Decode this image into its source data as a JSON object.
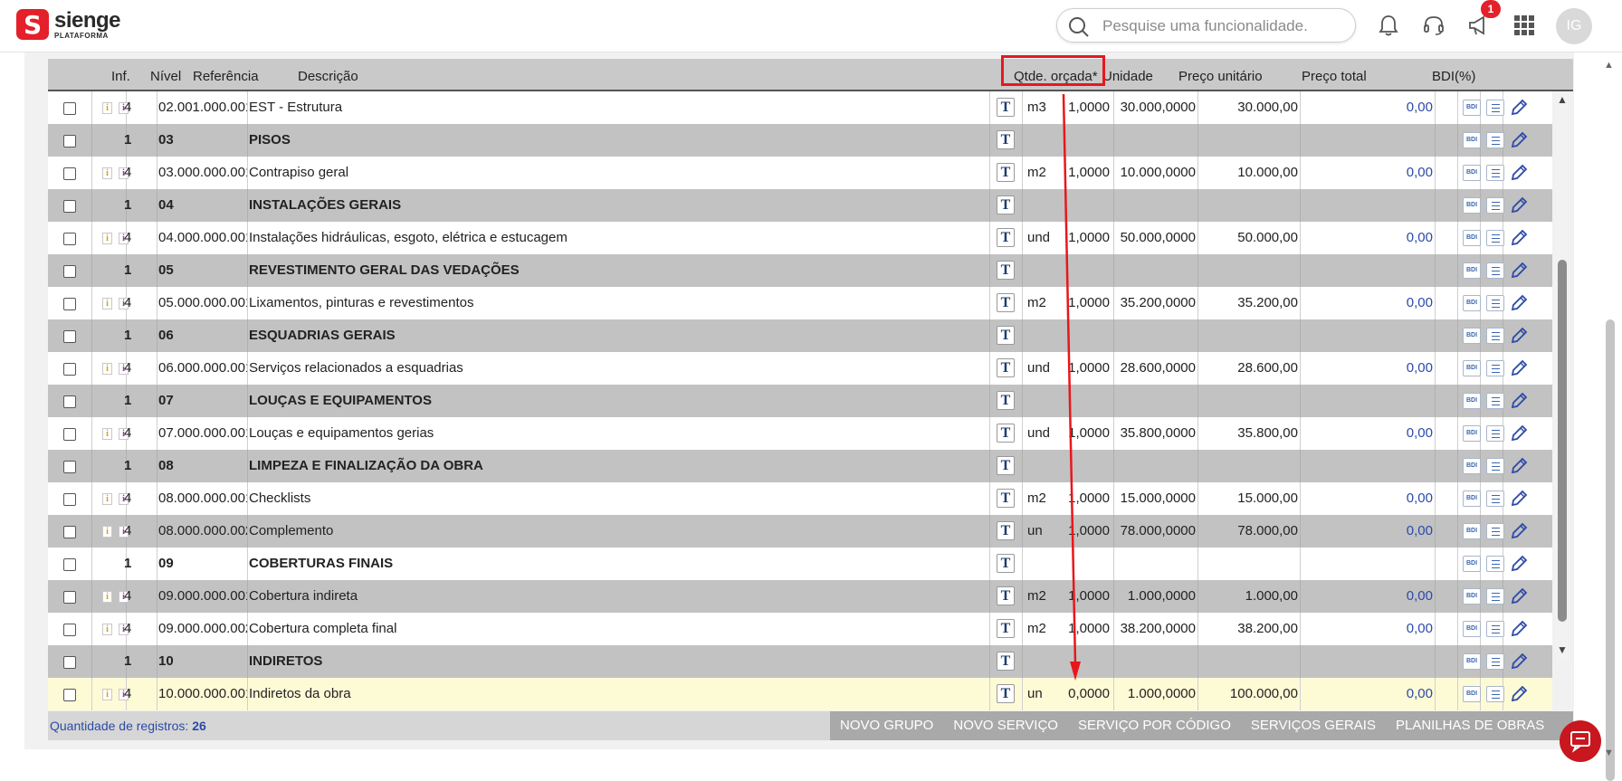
{
  "brand": {
    "name": "sienge",
    "sub": "PLATAFORMA",
    "mark": "S"
  },
  "search": {
    "placeholder": "Pesquise uma funcionalidade."
  },
  "notifications": {
    "badge": "1"
  },
  "user": {
    "initials": "IG"
  },
  "table": {
    "headers": {
      "inf": "Inf.",
      "nivel": "Nível",
      "referencia": "Referência",
      "descricao": "Descrição",
      "qtde": "Qtde. orçada*",
      "unidade": "Unidade",
      "preco_unitario": "Preço unitário",
      "preco_total": "Preço total",
      "bdi": "BDI(%)"
    },
    "text_button": "T",
    "bdi_button": "BDI",
    "rows": [
      {
        "type": "item",
        "shade": "white",
        "nivel": "4",
        "ref": "02.001.000.001",
        "desc": "EST - Estrutura",
        "qtde": "1,0000",
        "un": "m3",
        "pu": "30.000,0000",
        "pt": "30.000,00",
        "bdi": "0,00"
      },
      {
        "type": "group",
        "shade": "gray",
        "nivel": "1",
        "ref": "03",
        "desc": "PISOS"
      },
      {
        "type": "item",
        "shade": "white",
        "nivel": "4",
        "ref": "03.000.000.001",
        "desc": "Contrapiso geral",
        "qtde": "1,0000",
        "un": "m2",
        "pu": "10.000,0000",
        "pt": "10.000,00",
        "bdi": "0,00"
      },
      {
        "type": "group",
        "shade": "gray",
        "nivel": "1",
        "ref": "04",
        "desc": "INSTALAÇÕES GERAIS"
      },
      {
        "type": "item",
        "shade": "white",
        "nivel": "4",
        "ref": "04.000.000.001",
        "desc": "Instalações hidráulicas, esgoto, elétrica e estucagem",
        "qtde": "1,0000",
        "un": "und",
        "pu": "50.000,0000",
        "pt": "50.000,00",
        "bdi": "0,00"
      },
      {
        "type": "group",
        "shade": "gray",
        "nivel": "1",
        "ref": "05",
        "desc": "REVESTIMENTO GERAL DAS VEDAÇÕES"
      },
      {
        "type": "item",
        "shade": "white",
        "nivel": "4",
        "ref": "05.000.000.001",
        "desc": "Lixamentos, pinturas e revestimentos",
        "qtde": "1,0000",
        "un": "m2",
        "pu": "35.200,0000",
        "pt": "35.200,00",
        "bdi": "0,00"
      },
      {
        "type": "group",
        "shade": "gray",
        "nivel": "1",
        "ref": "06",
        "desc": "ESQUADRIAS GERAIS"
      },
      {
        "type": "item",
        "shade": "white",
        "nivel": "4",
        "ref": "06.000.000.001",
        "desc": "Serviços relacionados a esquadrias",
        "qtde": "1,0000",
        "un": "und",
        "pu": "28.600,0000",
        "pt": "28.600,00",
        "bdi": "0,00"
      },
      {
        "type": "group",
        "shade": "gray",
        "nivel": "1",
        "ref": "07",
        "desc": "LOUÇAS E EQUIPAMENTOS"
      },
      {
        "type": "item",
        "shade": "white",
        "nivel": "4",
        "ref": "07.000.000.001",
        "desc": "Louças e equipamentos gerias",
        "qtde": "1,0000",
        "un": "und",
        "pu": "35.800,0000",
        "pt": "35.800,00",
        "bdi": "0,00"
      },
      {
        "type": "group",
        "shade": "gray",
        "nivel": "1",
        "ref": "08",
        "desc": "LIMPEZA E FINALIZAÇÃO DA OBRA"
      },
      {
        "type": "item",
        "shade": "white",
        "nivel": "4",
        "ref": "08.000.000.001",
        "desc": "Checklists",
        "qtde": "1,0000",
        "un": "m2",
        "pu": "15.000,0000",
        "pt": "15.000,00",
        "bdi": "0,00"
      },
      {
        "type": "item",
        "shade": "gray",
        "nivel": "4",
        "ref": "08.000.000.002",
        "desc": "Complemento",
        "qtde": "1,0000",
        "un": "un",
        "pu": "78.000,0000",
        "pt": "78.000,00",
        "bdi": "0,00"
      },
      {
        "type": "group",
        "shade": "white",
        "nivel": "1",
        "ref": "09",
        "desc": "COBERTURAS FINAIS"
      },
      {
        "type": "item",
        "shade": "gray",
        "nivel": "4",
        "ref": "09.000.000.001",
        "desc": "Cobertura indireta",
        "qtde": "1,0000",
        "un": "m2",
        "pu": "1.000,0000",
        "pt": "1.000,00",
        "bdi": "0,00"
      },
      {
        "type": "item",
        "shade": "white",
        "nivel": "4",
        "ref": "09.000.000.002",
        "desc": "Cobertura completa final",
        "qtde": "1,0000",
        "un": "m2",
        "pu": "38.200,0000",
        "pt": "38.200,00",
        "bdi": "0,00"
      },
      {
        "type": "group",
        "shade": "gray",
        "nivel": "1",
        "ref": "10",
        "desc": "INDIRETOS"
      },
      {
        "type": "item",
        "shade": "sel",
        "nivel": "4",
        "ref": "10.000.000.001",
        "desc": "Indiretos da obra",
        "qtde": "0,0000",
        "un": "un",
        "pu": "1.000,0000",
        "pt": "100.000,00",
        "bdi": "0,00"
      }
    ]
  },
  "footer": {
    "count_label": "Quantidade de registros:",
    "count_value": "26",
    "buttons": [
      "NOVO GRUPO",
      "NOVO SERVIÇO",
      "SERVIÇO POR CÓDIGO",
      "SERVIÇOS GERAIS",
      "PLANILHAS DE OBRAS"
    ]
  },
  "colors": {
    "brand_red": "#e4202a",
    "annotation_red": "#e8171c",
    "link_blue": "#2b4aa8",
    "row_gray": "#c2c2c2",
    "selected_row": "#fdfbd6"
  }
}
